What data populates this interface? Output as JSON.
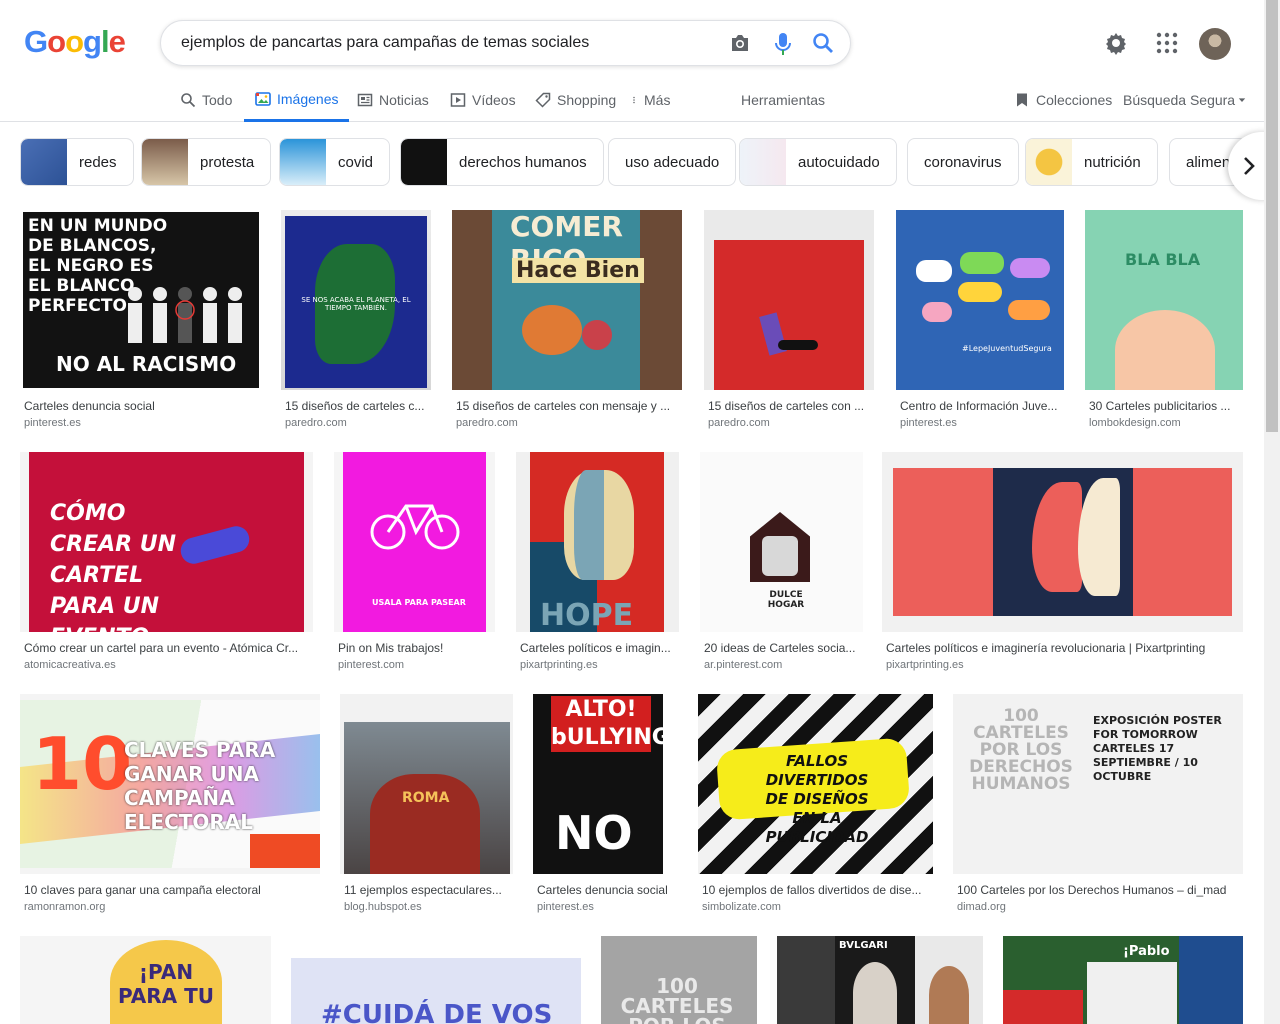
{
  "logo": "Google",
  "search": {
    "query": "ejemplos de pancartas para campañas de temas sociales"
  },
  "tabs": [
    {
      "label": "Todo",
      "icon": "search-icon"
    },
    {
      "label": "Imágenes",
      "icon": "image-icon"
    },
    {
      "label": "Noticias",
      "icon": "news-icon"
    },
    {
      "label": "Vídeos",
      "icon": "play-icon"
    },
    {
      "label": "Shopping",
      "icon": "tag-icon"
    },
    {
      "label": "Más",
      "icon": "more-vert-icon"
    },
    {
      "label": "Herramientas"
    }
  ],
  "right_tools": {
    "collections": "Colecciones",
    "safe_search": "Búsqueda Segura"
  },
  "chips": [
    "redes",
    "protesta",
    "covid",
    "derechos humanos",
    "uso adecuado",
    "autocuidado",
    "coronavirus",
    "nutrición",
    "alimen"
  ],
  "results": [
    {
      "title": "Carteles denuncia social",
      "source": "pinterest.es",
      "poster": "EN UN MUNDO DE BLANCOS, EL NEGRO ES EL BLANCO PERFECTO",
      "poster2": "NO AL RACISMO"
    },
    {
      "title": "15 diseños de carteles c...",
      "source": "paredro.com",
      "poster": "SE NOS ACABA EL PLANETA, EL TIEMPO TAMBIÉN."
    },
    {
      "title": "15 diseños de carteles con mensaje y ...",
      "source": "paredro.com",
      "poster": "COMER RICO",
      "poster2": "Hace Bien"
    },
    {
      "title": "15 diseños de carteles con ...",
      "source": "paredro.com"
    },
    {
      "title": "Centro de Información Juve...",
      "source": "pinterest.es",
      "poster": "#LepeJuventudSegura"
    },
    {
      "title": "30 Carteles publicitarios ...",
      "source": "lombokdesign.com",
      "poster": "BLA BLA"
    },
    {
      "title": "Cómo crear un cartel para un evento - Atómica Cr...",
      "source": "atomicacreativa.es",
      "poster": "CÓMO CREAR UN CARTEL PARA UN EVENTO"
    },
    {
      "title": "Pin on Mis trabajos!",
      "source": "pinterest.com",
      "poster": "USALA PARA PASEAR"
    },
    {
      "title": "Carteles políticos e imagin...",
      "source": "pixartprinting.es",
      "poster": "HOPE"
    },
    {
      "title": "20 ideas de Carteles socia...",
      "source": "ar.pinterest.com",
      "poster": "DULCE HOGAR"
    },
    {
      "title": "Carteles políticos e imaginería revolucionaria | Pixartprinting",
      "source": "pixartprinting.es"
    },
    {
      "title": "10 claves para ganar una campaña electoral",
      "source": "ramonramon.org",
      "poster": "10",
      "poster2": "CLAVES PARA GANAR UNA CAMPAÑA ELECTORAL"
    },
    {
      "title": "11 ejemplos espectaculares...",
      "source": "blog.hubspot.es",
      "poster": "ROMA"
    },
    {
      "title": "Carteles denuncia social",
      "source": "pinterest.es",
      "poster": "ALTO! bULLYING",
      "poster2": "NO"
    },
    {
      "title": "10 ejemplos de fallos divertidos de dise...",
      "source": "simbolizate.com",
      "poster": "FALLOS DIVERTIDOS DE DISEÑOS EN LA PUBLICIDAD"
    },
    {
      "title": "100 Carteles por los Derechos Humanos – di_mad",
      "source": "dimad.org",
      "poster": "100 CARTELES POR LOS DERECHOS HUMANOS",
      "poster2": "EXPOSICIÓN POSTER FOR TOMORROW CARTELES 17 SEPTIEMBRE / 10 OCTUBRE"
    },
    {
      "title": "",
      "source": "",
      "poster": "¡PAN PARA TU"
    },
    {
      "title": "",
      "source": "",
      "poster": "#CUIDÁ DE VOS"
    },
    {
      "title": "",
      "source": "",
      "poster": "100 CARTELES POR LOS"
    },
    {
      "title": "",
      "source": "",
      "poster": "BVLGARI"
    },
    {
      "title": "",
      "source": "",
      "poster": "¡Pablo"
    }
  ]
}
